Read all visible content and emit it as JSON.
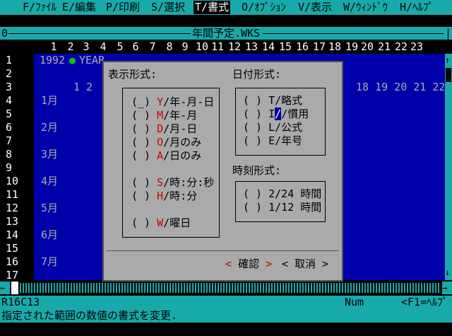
{
  "menu": [
    {
      "label": "F/ﾌｧｲﾙ",
      "active": false
    },
    {
      "label": "E/編集",
      "active": false
    },
    {
      "label": "P/印刷",
      "active": false
    },
    {
      "label": "S/選択",
      "active": false
    },
    {
      "label": "T/書式",
      "active": true
    },
    {
      "label": "O/ｵﾌﾟｼｮﾝ",
      "active": false
    },
    {
      "label": "V/表示",
      "active": false
    },
    {
      "label": "W/ｳｨﾝﾄﾞｳ",
      "active": false
    },
    {
      "label": "H/ﾍﾙﾌﾟ",
      "active": false
    }
  ],
  "window": {
    "title": "年間予定.WKS",
    "number": "0"
  },
  "columns": [
    "1",
    "2",
    "3",
    "4",
    "5",
    "6",
    "7",
    "8",
    "9",
    "10",
    "11",
    "12",
    "13",
    "14",
    "15",
    "16",
    "17",
    "18",
    "19",
    "20",
    "21",
    "22",
    "23"
  ],
  "rows": [
    "1",
    "2",
    "3",
    "4",
    "5",
    "6",
    "7",
    "8",
    "9",
    "10",
    "11",
    "12",
    "13",
    "14",
    "15",
    "16",
    "17"
  ],
  "cells": {
    "a1_year": "1992",
    "b1_label": "YEAR",
    "row3_left": "1  2",
    "row3_right": "18 19 20 21 22",
    "months": [
      "1月",
      "2月",
      "3月",
      "4月",
      "5月",
      "6月",
      "7月"
    ]
  },
  "dialog": {
    "display_format_label": "表示形式:",
    "display_options": [
      {
        "key": "Y",
        "text": "/年-月-日"
      },
      {
        "key": "M",
        "text": "/年-月"
      },
      {
        "key": "D",
        "text": "/月-日"
      },
      {
        "key": "O",
        "text": "/月のみ"
      },
      {
        "key": "A",
        "text": "/日のみ"
      },
      {
        "key": "S",
        "text": "/時:分:秒"
      },
      {
        "key": "H",
        "text": "/時:分"
      },
      {
        "key": "W",
        "text": "/曜日"
      }
    ],
    "date_format_label": "日付形式:",
    "date_options": [
      {
        "key": "T",
        "text": "/略式"
      },
      {
        "key": "I",
        "text": "/慣用"
      },
      {
        "key": "L",
        "text": "/公式"
      },
      {
        "key": "E",
        "text": "/年号"
      }
    ],
    "time_format_label": "時刻形式:",
    "time_options": [
      "2/24 時間",
      "1/12 時間"
    ],
    "radio_empty": "( )",
    "radio_cursor": "(_)",
    "ok_label": "確認",
    "cancel_label": "取消"
  },
  "status": {
    "cell": "R16C13",
    "mode": "Num",
    "help": "<F1=ﾍﾙﾌﾟ>"
  },
  "message": "指定された範囲の数値の書式を変更.",
  "colors": {
    "grid": "#0000aa",
    "bar": "#18aaaa",
    "dialog": "#aaaaaa",
    "accent": "#cc0000",
    "disabled": "#aa5500"
  }
}
